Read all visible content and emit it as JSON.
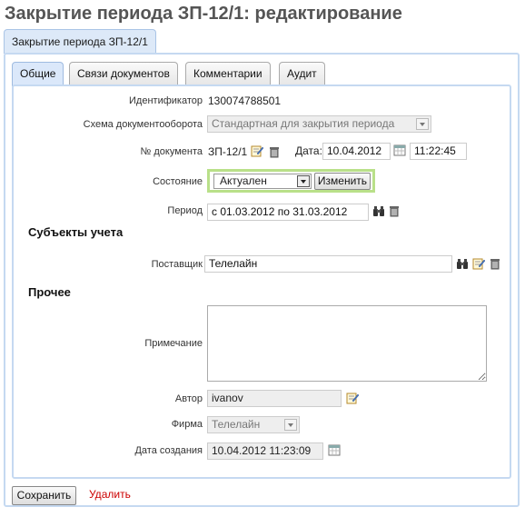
{
  "page": {
    "title": "Закрытие периода ЗП-12/1: редактирование"
  },
  "outer_tab": {
    "label": "Закрытие периода ЗП-12/1"
  },
  "tabs": [
    {
      "label": "Общие"
    },
    {
      "label": "Связи документов"
    },
    {
      "label": "Комментарии"
    },
    {
      "label": "Аудит"
    }
  ],
  "form": {
    "identifier": {
      "label": "Идентификатор",
      "value": "130074788501"
    },
    "workflow": {
      "label": "Схема документооборота",
      "value": "Стандартная для закрытия периода"
    },
    "doc_number": {
      "label": "№ документа",
      "value": "ЗП-12/1",
      "date_label": "Дата:",
      "date": "10.04.2012",
      "time": "11:22:45"
    },
    "state": {
      "label": "Состояние",
      "value": "Актуален",
      "change_button": "Изменить"
    },
    "period": {
      "label": "Период",
      "value": "с 01.03.2012 по 31.03.2012"
    },
    "subjects_section": "Субъекты учета",
    "supplier": {
      "label": "Поставщик",
      "value": "Телелайн"
    },
    "other_section": "Прочее",
    "note": {
      "label": "Примечание",
      "value": ""
    },
    "author": {
      "label": "Автор",
      "value": "ivanov"
    },
    "firm": {
      "label": "Фирма",
      "value": "Телелайн"
    },
    "created": {
      "label": "Дата создания",
      "value": "10.04.2012 11:23:09"
    }
  },
  "actions": {
    "save": "Сохранить",
    "delete": "Удалить"
  },
  "colors": {
    "accent": "#c5d9f1",
    "state_highlight": "#b9e089",
    "delete": "#cc0000"
  }
}
